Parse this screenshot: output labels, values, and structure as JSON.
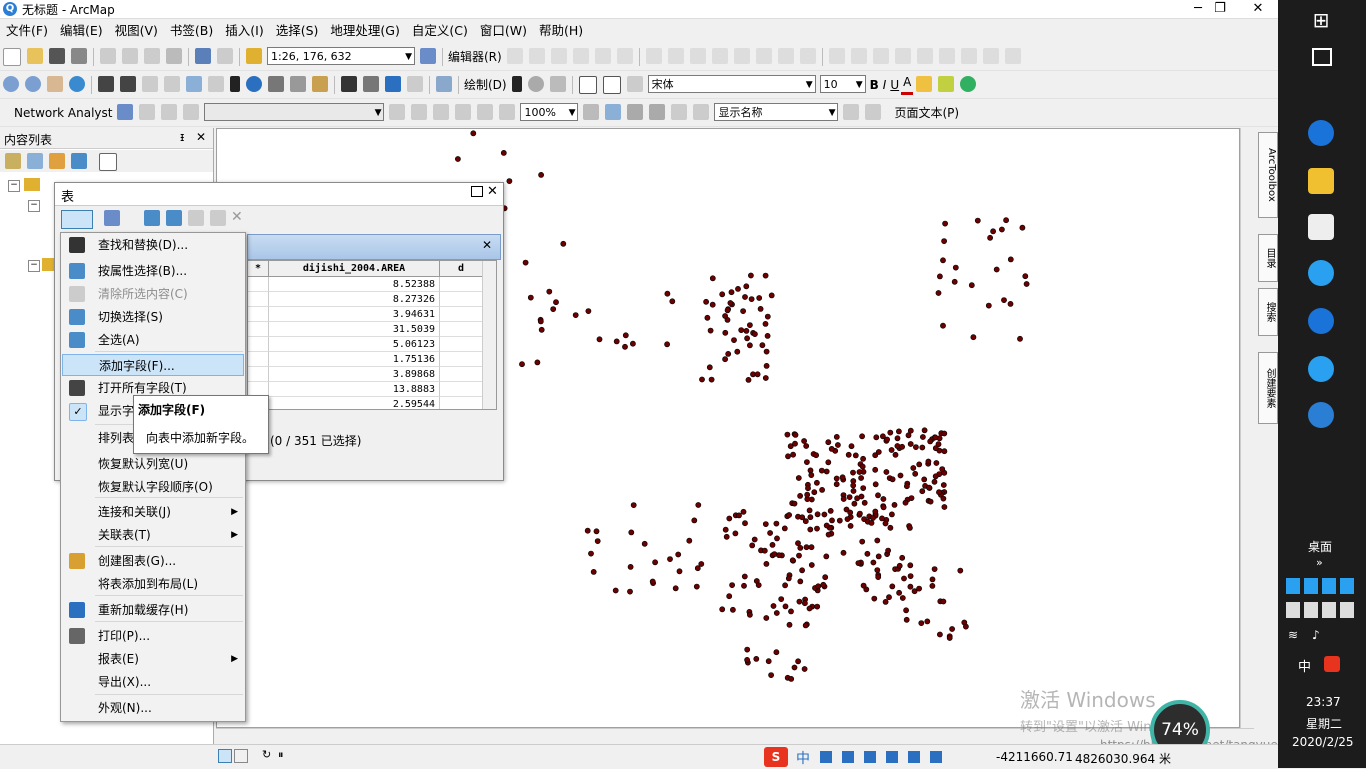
{
  "window": {
    "title": "无标题 - ArcMap",
    "minimize": "─",
    "restore": "❐",
    "close": "✕"
  },
  "menu": [
    "文件(F)",
    "编辑(E)",
    "视图(V)",
    "书签(B)",
    "插入(I)",
    "选择(S)",
    "地理处理(G)",
    "自定义(C)",
    "窗口(W)",
    "帮助(H)"
  ],
  "toolbar1": {
    "scale": "1:26, 176, 632",
    "editor": "编辑器(R)"
  },
  "toolbar2": {
    "draw": "绘制(D)",
    "font": "宋体",
    "font_size": "10",
    "bold": "B",
    "italic": "I",
    "underline": "U",
    "font_color_label": "A"
  },
  "toolbar3": {
    "network_analyst": "Network Analyst",
    "zoom": "100%",
    "display_name": "显示名称",
    "page_text": "页面文本(P)"
  },
  "toc": {
    "title": "内容列表",
    "pin": "ᵻ",
    "close": "✕"
  },
  "table_window": {
    "title": "表",
    "records_status": "(0 / 351 已选择)",
    "columns": [
      "*",
      "dijishi_2004.AREA",
      "d"
    ],
    "area_values": [
      "8.52388",
      "8.27326",
      "3.94631",
      "31.5039",
      "5.06123",
      "1.75136",
      "3.89868",
      "13.8883",
      "2.59544"
    ]
  },
  "context_menu": {
    "items": [
      {
        "label": "查找和替换(D)...",
        "icon": "binoculars-icon",
        "disabled": false
      },
      {
        "label": "按属性选择(B)...",
        "icon": "select-by-attributes-icon",
        "disabled": false
      },
      {
        "label": "清除所选内容(C)",
        "icon": "clear-selection-icon",
        "disabled": true
      },
      {
        "label": "切换选择(S)",
        "icon": "switch-selection-icon",
        "disabled": false
      },
      {
        "label": "全选(A)",
        "icon": "select-all-icon",
        "disabled": false
      },
      {
        "label": "添加字段(F)...",
        "icon": "",
        "disabled": false,
        "highlighted": true
      },
      {
        "label": "打开所有字段(T)",
        "icon": "fields-icon",
        "disabled": false
      },
      {
        "label": "显示字",
        "icon": "check-icon",
        "disabled": false
      },
      {
        "label": "排列表",
        "icon": "",
        "disabled": false,
        "submenu": true
      },
      {
        "label": "恢复默认列宽(U)",
        "icon": "",
        "disabled": false
      },
      {
        "label": "恢复默认字段顺序(O)",
        "icon": "",
        "disabled": false
      },
      {
        "label": "连接和关联(J)",
        "icon": "",
        "disabled": false,
        "submenu": true
      },
      {
        "label": "关联表(T)",
        "icon": "",
        "disabled": false,
        "submenu": true
      },
      {
        "label": "创建图表(G)...",
        "icon": "chart-icon",
        "disabled": false
      },
      {
        "label": "将表添加到布局(L)",
        "icon": "",
        "disabled": false
      },
      {
        "label": "重新加载缓存(H)",
        "icon": "refresh-icon",
        "disabled": false
      },
      {
        "label": "打印(P)...",
        "icon": "printer-icon",
        "disabled": false
      },
      {
        "label": "报表(E)",
        "icon": "",
        "disabled": false,
        "submenu": true
      },
      {
        "label": "导出(X)...",
        "icon": "",
        "disabled": false
      },
      {
        "label": "外观(N)...",
        "icon": "",
        "disabled": false
      }
    ],
    "submenu_arrow": "▶"
  },
  "tooltip": {
    "title": "添加字段(F)",
    "body": "向表中添加新字段。"
  },
  "right_dock": [
    "ArcToolbox",
    "目录",
    "搜索",
    "创建要素"
  ],
  "status_bar": {
    "x": "-4211660.71",
    "y": "4826030.964 米",
    "ime": "中"
  },
  "watermark": {
    "line1": "激活 Windows",
    "line2": "转到\"设置\"以激活 Windows。",
    "url": "https://blog.csdn.net/tangyuechenxi"
  },
  "cpu_percent": "74%",
  "taskbar": {
    "desktop": "桌面",
    "time": "23:37",
    "weekday": "星期二",
    "date": "2020/2/25",
    "ime": "中"
  },
  "colors": {
    "accent": "#cce4f7",
    "point": "#6b0000",
    "taskbar": "#1c1c1c"
  }
}
